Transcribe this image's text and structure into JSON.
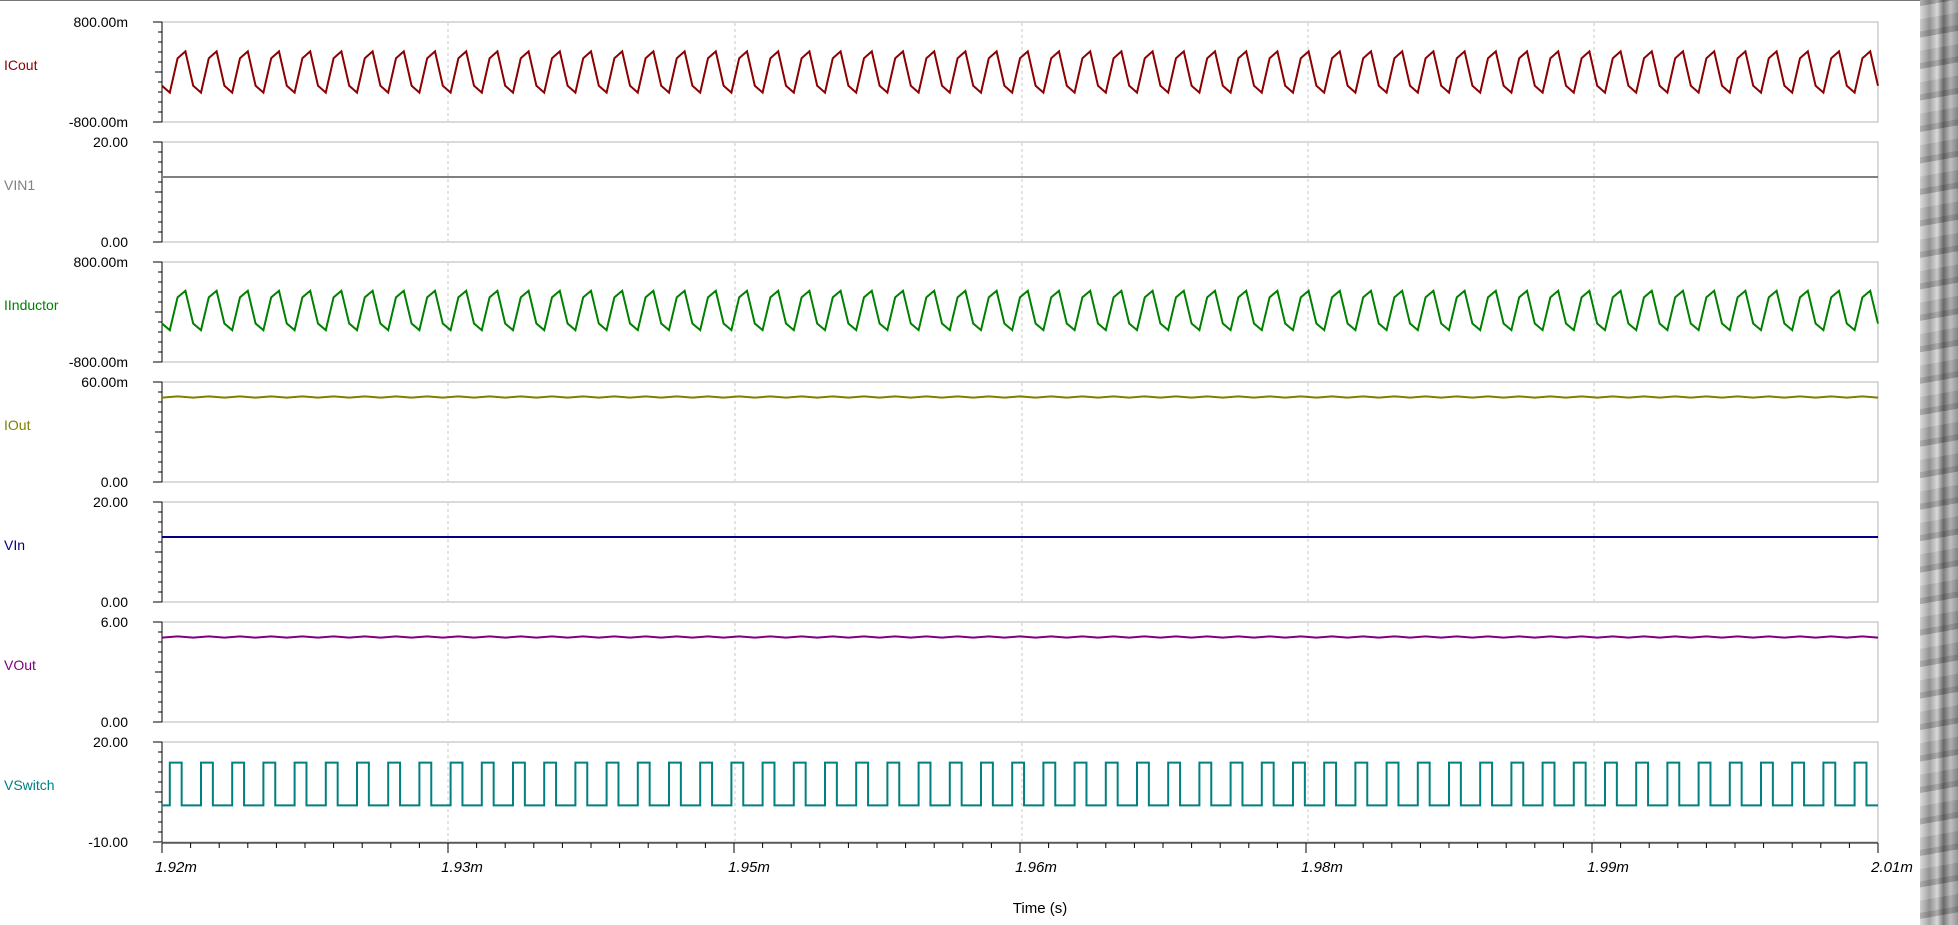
{
  "chart_data": {
    "type": "line",
    "xlabel": "Time (s)",
    "x_ticks": [
      "1.92m",
      "1.93m",
      "1.95m",
      "1.96m",
      "1.98m",
      "1.99m",
      "2.01m"
    ],
    "xlim": [
      0.00192,
      0.00201
    ],
    "panels": [
      {
        "name": "ICout",
        "color": "#8B0000",
        "ymax_label": "800.00m",
        "ymin_label": "-800.00m",
        "ylim": [
          -0.8,
          0.8
        ],
        "shape": "triangle",
        "low": -0.55,
        "high": 0.55,
        "cycles": 55,
        "phase": 0.85
      },
      {
        "name": "VIN1",
        "color": "#808080",
        "ymax_label": "20.00",
        "ymin_label": "0.00",
        "ylim": [
          0,
          20
        ],
        "shape": "flat",
        "value": 13
      },
      {
        "name": "IInductor",
        "color": "#008000",
        "ymax_label": "800.00m",
        "ymin_label": "-800.00m",
        "ylim": [
          -0.8,
          0.8
        ],
        "shape": "triangle",
        "low": -0.5,
        "high": 0.55,
        "cycles": 55,
        "phase": 0.85
      },
      {
        "name": "IOut",
        "color": "#808000",
        "ymax_label": "60.00m",
        "ymin_label": "0.00",
        "ylim": [
          0,
          0.06
        ],
        "shape": "ripple",
        "value": 0.051,
        "amplitude": 0.0004,
        "cycles": 55
      },
      {
        "name": "VIn",
        "color": "#000080",
        "ymax_label": "20.00",
        "ymin_label": "0.00",
        "ylim": [
          0,
          20
        ],
        "shape": "flat",
        "value": 13
      },
      {
        "name": "VOut",
        "color": "#800080",
        "ymax_label": "6.00",
        "ymin_label": "0.00",
        "ylim": [
          0,
          6
        ],
        "shape": "ripple",
        "value": 5.1,
        "amplitude": 0.04,
        "cycles": 55
      },
      {
        "name": "VSwitch",
        "color": "#008080",
        "ymax_label": "20.00",
        "ymin_label": "-10.00",
        "ylim": [
          -10,
          20
        ],
        "shape": "square",
        "low": 1,
        "high": 13.8,
        "cycles": 55,
        "duty": 0.38
      }
    ]
  }
}
